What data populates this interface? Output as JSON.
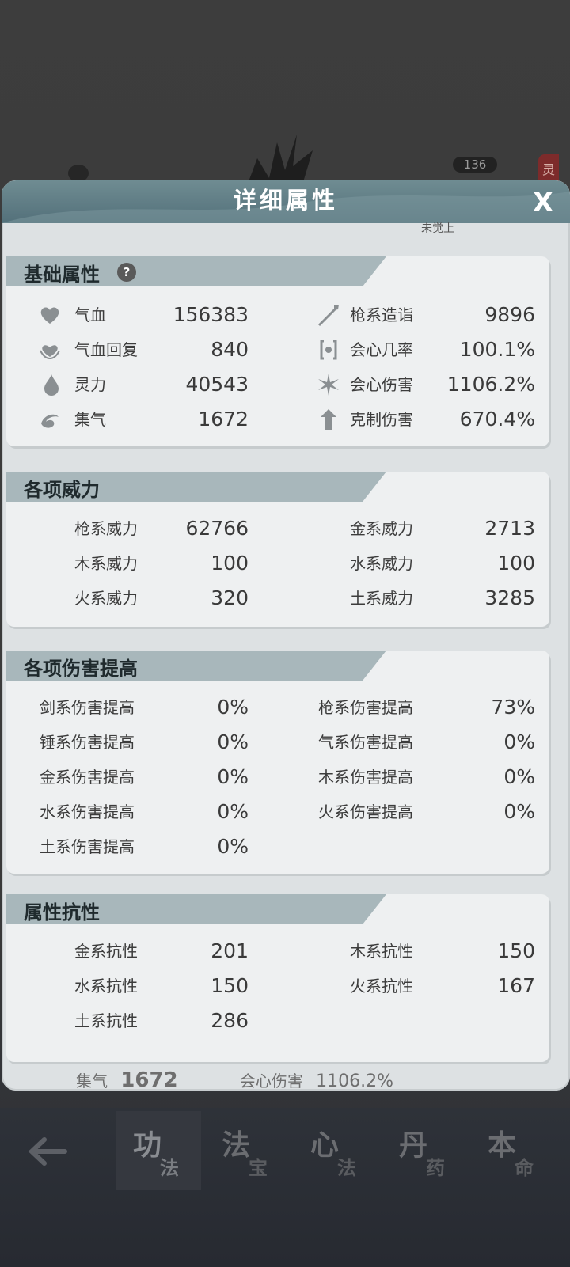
{
  "background": {
    "badge_count": "136",
    "side_tab": "灵",
    "peek_text": "未觉上",
    "behind_row": {
      "stat1_label": "集气",
      "stat1_value": "1672",
      "stat2_label": "会心伤害",
      "stat2_value": "1106.2%"
    }
  },
  "dialog": {
    "title": "详细属性",
    "close": "X"
  },
  "basic": {
    "title": "基础属性",
    "help": "?",
    "left": [
      {
        "icon": "heart-icon",
        "label": "气血",
        "value": "156383"
      },
      {
        "icon": "heart-regen-icon",
        "label": "气血回复",
        "value": "840"
      },
      {
        "icon": "flame-drop-icon",
        "label": "灵力",
        "value": "40543"
      },
      {
        "icon": "swirl-icon",
        "label": "集气",
        "value": "1672"
      }
    ],
    "right": [
      {
        "icon": "spear-icon",
        "label": "枪系造诣",
        "value": "9896"
      },
      {
        "icon": "crit-rate-icon",
        "label": "会心几率",
        "value": "100.1%"
      },
      {
        "icon": "crit-damage-icon",
        "label": "会心伤害",
        "value": "1106.2%"
      },
      {
        "icon": "counter-damage-icon",
        "label": "克制伤害",
        "value": "670.4%"
      }
    ]
  },
  "power": {
    "title": "各项威力",
    "left": [
      {
        "label": "枪系威力",
        "value": "62766"
      },
      {
        "label": "木系威力",
        "value": "100"
      },
      {
        "label": "火系威力",
        "value": "320"
      }
    ],
    "right": [
      {
        "label": "金系威力",
        "value": "2713"
      },
      {
        "label": "水系威力",
        "value": "100"
      },
      {
        "label": "土系威力",
        "value": "3285"
      }
    ]
  },
  "damage": {
    "title": "各项伤害提高",
    "left": [
      {
        "label": "剑系伤害提高",
        "value": "0%"
      },
      {
        "label": "锤系伤害提高",
        "value": "0%"
      },
      {
        "label": "金系伤害提高",
        "value": "0%"
      },
      {
        "label": "水系伤害提高",
        "value": "0%"
      },
      {
        "label": "土系伤害提高",
        "value": "0%"
      }
    ],
    "right": [
      {
        "label": "枪系伤害提高",
        "value": "73%"
      },
      {
        "label": "气系伤害提高",
        "value": "0%"
      },
      {
        "label": "木系伤害提高",
        "value": "0%"
      },
      {
        "label": "火系伤害提高",
        "value": "0%"
      }
    ]
  },
  "resist": {
    "title": "属性抗性",
    "left": [
      {
        "label": "金系抗性",
        "value": "201"
      },
      {
        "label": "水系抗性",
        "value": "150"
      },
      {
        "label": "土系抗性",
        "value": "286"
      }
    ],
    "right": [
      {
        "label": "木系抗性",
        "value": "150"
      },
      {
        "label": "火系抗性",
        "value": "167"
      }
    ]
  },
  "nav": {
    "tabs": [
      {
        "big": "功",
        "small": "法"
      },
      {
        "big": "法",
        "small": "宝"
      },
      {
        "big": "心",
        "small": "法"
      },
      {
        "big": "丹",
        "small": "药"
      },
      {
        "big": "本",
        "small": "命"
      }
    ]
  }
}
